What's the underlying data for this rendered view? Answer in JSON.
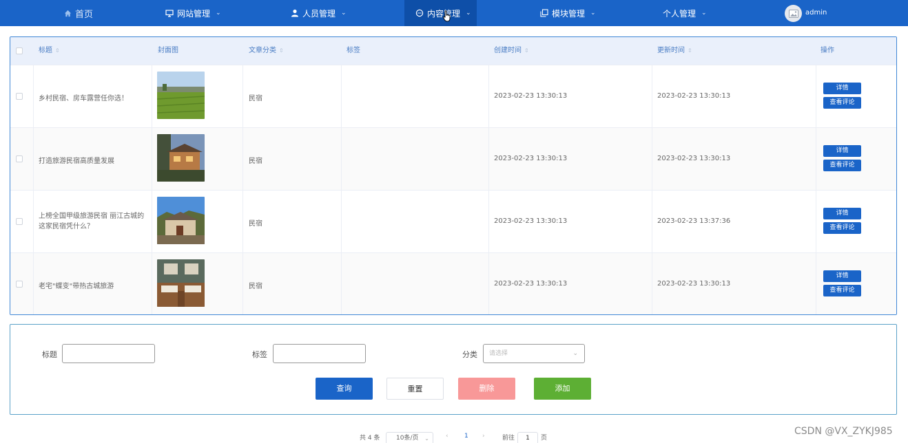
{
  "nav": {
    "home": "首页",
    "site": "网站管理",
    "people": "人员管理",
    "content": "内容管理",
    "module": "模块管理",
    "personal": "个人管理",
    "user": "admin"
  },
  "table": {
    "headers": {
      "title": "标题",
      "cover": "封面图",
      "category": "文章分类",
      "tag": "标签",
      "created": "创建时间",
      "updated": "更新时间",
      "actions": "操作"
    },
    "detail_label": "详情",
    "comments_label": "查看评论",
    "rows": [
      {
        "title": "乡村民宿、房车露营任你选！",
        "category": "民宿",
        "tag": "",
        "created": "2023-02-23 13:30:13",
        "updated": "2023-02-23 13:30:13"
      },
      {
        "title": "打造旅游民宿高质量发展",
        "category": "民宿",
        "tag": "",
        "created": "2023-02-23 13:30:13",
        "updated": "2023-02-23 13:30:13"
      },
      {
        "title": "上榜全国甲级旅游民宿 丽江古城的这家民宿凭什么？",
        "category": "民宿",
        "tag": "",
        "created": "2023-02-23 13:30:13",
        "updated": "2023-02-23 13:37:36"
      },
      {
        "title": "老宅\"蝶变\"带热古城旅游",
        "category": "民宿",
        "tag": "",
        "created": "2023-02-23 13:30:13",
        "updated": "2023-02-23 13:30:13"
      }
    ]
  },
  "search": {
    "title_label": "标题",
    "tag_label": "标签",
    "category_label": "分类",
    "category_placeholder": "请选择",
    "query": "查询",
    "reset": "重置",
    "delete": "删除",
    "add": "添加"
  },
  "pager": {
    "total": "共 4 条",
    "page_size": "10条/页",
    "current": "1",
    "goto_prefix": "前往",
    "goto_value": "1",
    "goto_suffix": "页"
  },
  "watermark": "CSDN @VX_ZYKJ985",
  "colors": {
    "primary": "#1a64c8",
    "danger_light": "#f89898",
    "success": "#5daf34"
  }
}
